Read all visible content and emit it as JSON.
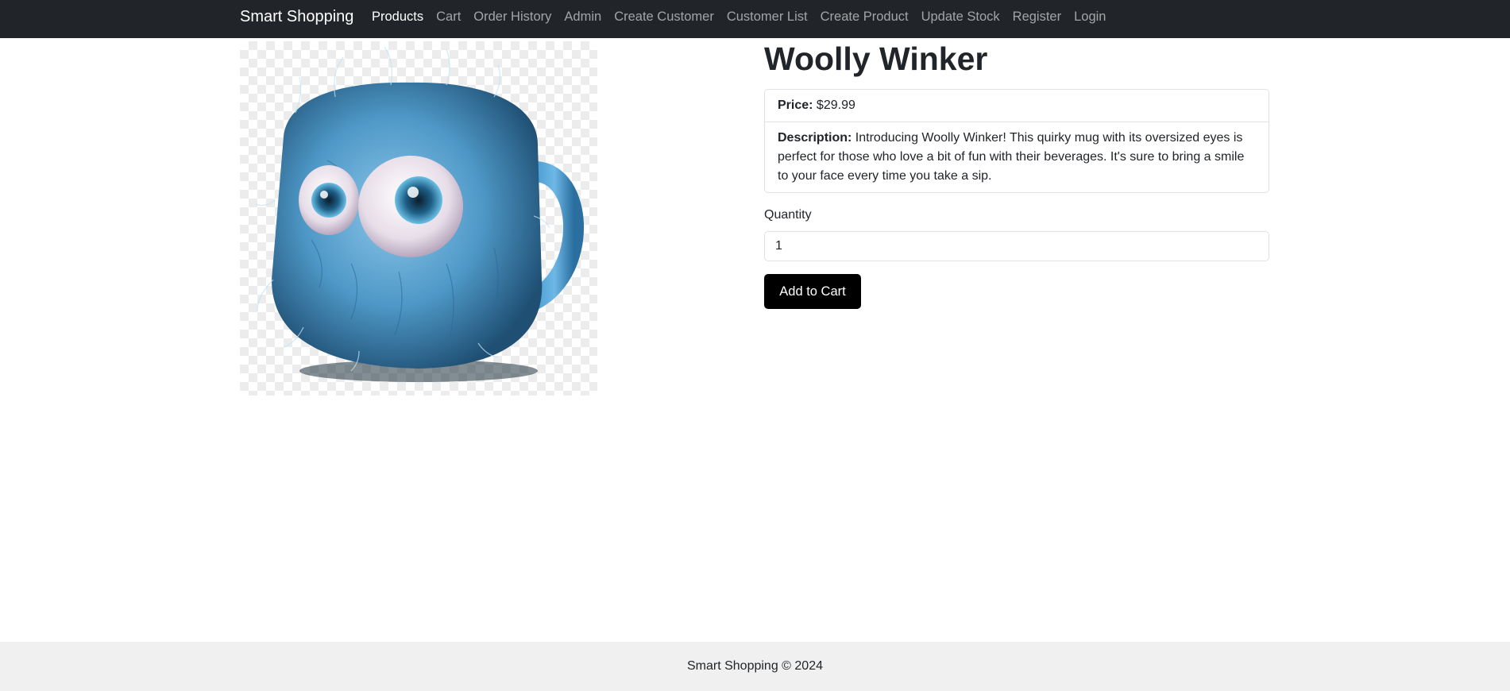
{
  "navbar": {
    "brand": "Smart Shopping",
    "links": [
      {
        "label": "Products",
        "active": true
      },
      {
        "label": "Cart"
      },
      {
        "label": "Order History"
      },
      {
        "label": "Admin"
      },
      {
        "label": "Create Customer"
      },
      {
        "label": "Customer List"
      },
      {
        "label": "Create Product"
      },
      {
        "label": "Update Stock"
      },
      {
        "label": "Register"
      },
      {
        "label": "Login"
      }
    ]
  },
  "product": {
    "name": "Woolly Winker",
    "image_icon": "fluffy-blue-mug-image",
    "price_label": "Price:",
    "price": "$29.99",
    "description_label": "Description:",
    "description": "Introducing Woolly Winker! This quirky mug with its oversized eyes is perfect for those who love a bit of fun with their beverages. It's sure to bring a smile to your face every time you take a sip."
  },
  "form": {
    "quantity_label": "Quantity",
    "quantity_value": "1",
    "add_to_cart_label": "Add to Cart"
  },
  "footer": {
    "text": "Smart Shopping © 2024"
  },
  "colors": {
    "navbar_bg": "#212529",
    "button_bg": "#000000",
    "footer_bg": "#f0f0f0",
    "mug_blue": "#5ea9d6"
  }
}
